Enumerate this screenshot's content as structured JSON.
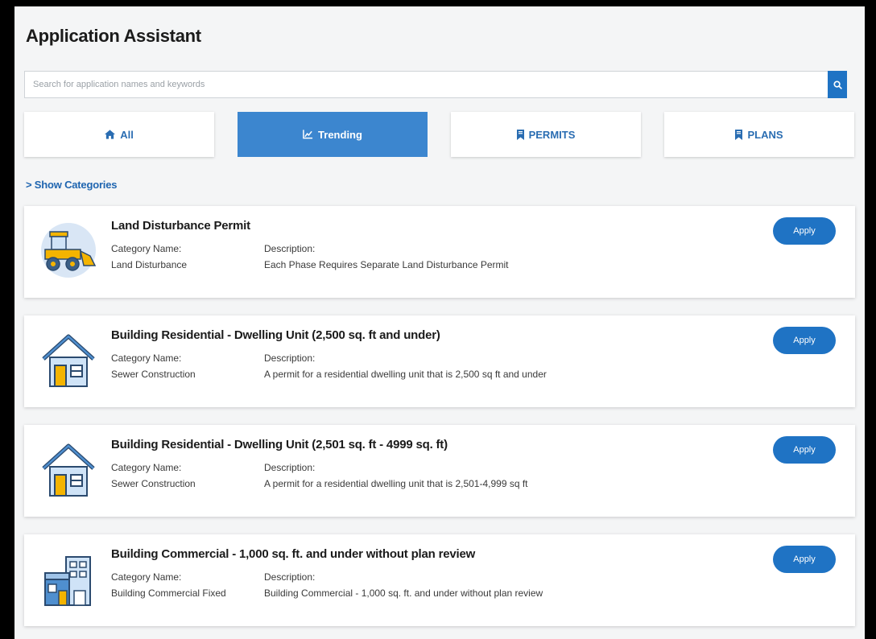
{
  "header": {
    "title": "Application Assistant"
  },
  "search": {
    "placeholder": "Search for application names and keywords",
    "value": ""
  },
  "tabs": [
    {
      "label": "All",
      "icon": "home-icon",
      "active": false
    },
    {
      "label": "Trending",
      "icon": "trending-chart-icon",
      "active": true
    },
    {
      "label": "PERMITS",
      "icon": "bookmark-icon",
      "active": false
    },
    {
      "label": "PLANS",
      "icon": "bookmark-icon",
      "active": false
    }
  ],
  "show_categories": "> Show Categories",
  "labels": {
    "category": "Category Name:",
    "description": "Description:"
  },
  "apply_label": "Apply",
  "cards": [
    {
      "title": "Land Disturbance Permit",
      "category": "Land Disturbance",
      "description": "Each Phase Requires Separate Land Disturbance Permit",
      "icon": "bulldozer-icon"
    },
    {
      "title": "Building Residential - Dwelling Unit (2,500 sq. ft and under)",
      "category": "Sewer Construction",
      "description": "A permit for a residential dwelling unit that is 2,500 sq ft and under",
      "icon": "house-icon"
    },
    {
      "title": "Building Residential - Dwelling Unit (2,501 sq. ft - 4999 sq. ft)",
      "category": "Sewer Construction",
      "description": "A permit for a residential dwelling unit that is 2,501-4,999 sq ft",
      "icon": "house-icon"
    },
    {
      "title": "Building Commercial - 1,000 sq. ft. and under without plan review",
      "category": "Building Commercial Fixed",
      "description": "Building Commercial - 1,000 sq. ft. and under without plan review",
      "icon": "commercial-building-icon"
    }
  ],
  "colors": {
    "accent": "#1f73c4",
    "active_tab": "#3c86cf",
    "link": "#1f65b0"
  }
}
